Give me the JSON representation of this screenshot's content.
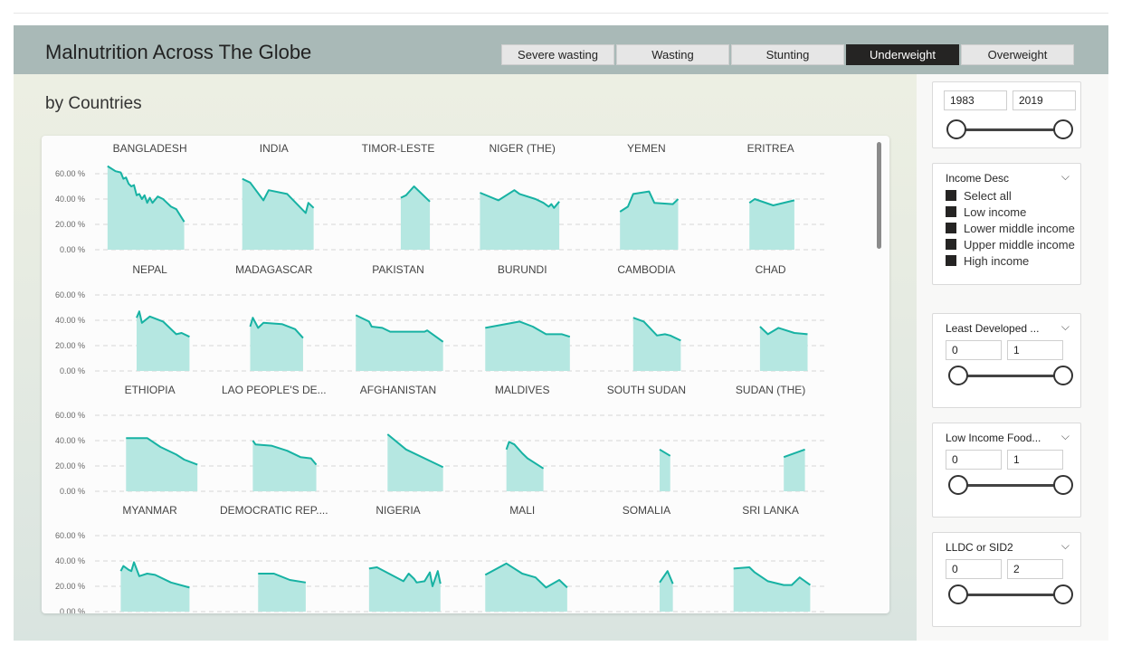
{
  "app": {
    "title": "Malnutrition Across The Globe",
    "subtitle": "by Countries"
  },
  "tabs": [
    {
      "label": "Severe wasting",
      "active": false
    },
    {
      "label": "Wasting",
      "active": false
    },
    {
      "label": "Stunting",
      "active": false
    },
    {
      "label": "Underweight",
      "active": true
    },
    {
      "label": "Overweight",
      "active": false
    }
  ],
  "colors": {
    "header": "#a9b9b7",
    "line": "#17b2a3",
    "area": "#b5e7e1",
    "active_tab": "#252423"
  },
  "filters": {
    "year_range": {
      "from": "1983",
      "to": "2019",
      "low_fraction": 0,
      "high_fraction": 1
    },
    "income": {
      "title": "Income Desc",
      "icon": "chevron-down-icon",
      "options": [
        "Select all",
        "Low income",
        "Lower middle income",
        "Upper middle income",
        "High income"
      ]
    },
    "ldc": {
      "title": "Least Developed ...",
      "from": "0",
      "to": "1",
      "low_fraction": 0,
      "high_fraction": 1
    },
    "lifdc": {
      "title": "Low Income Food...",
      "from": "0",
      "to": "1",
      "low_fraction": 0,
      "high_fraction": 1
    },
    "lldc": {
      "title": "LLDC or SID2",
      "from": "0",
      "to": "2",
      "low_fraction": 0,
      "high_fraction": 1
    }
  },
  "chart_data": {
    "type": "area",
    "y_ticks": [
      "60.00 %",
      "40.00 %",
      "20.00 %",
      "0.00 %"
    ],
    "ylim": [
      0,
      60
    ],
    "xlim": [
      1983,
      2019
    ],
    "grid": true,
    "panels": [
      {
        "name": "BANGLADESH",
        "points": [
          [
            1985,
            66
          ],
          [
            1988,
            62
          ],
          [
            1990,
            61
          ],
          [
            1991,
            56
          ],
          [
            1992,
            57
          ],
          [
            1993,
            52
          ],
          [
            1994,
            50
          ],
          [
            1995,
            51
          ],
          [
            1996,
            43
          ],
          [
            1997,
            44
          ],
          [
            1998,
            40
          ],
          [
            1999,
            43
          ],
          [
            2000,
            37
          ],
          [
            2001,
            41
          ],
          [
            2002,
            37
          ],
          [
            2004,
            42
          ],
          [
            2006,
            40
          ],
          [
            2007,
            38
          ],
          [
            2009,
            34
          ],
          [
            2011,
            32
          ],
          [
            2014,
            22
          ]
        ]
      },
      {
        "name": "INDIA",
        "points": [
          [
            1989,
            56
          ],
          [
            1992,
            53
          ],
          [
            1997,
            39
          ],
          [
            1999,
            47
          ],
          [
            2006,
            44
          ],
          [
            2013,
            29
          ],
          [
            2014,
            37
          ],
          [
            2016,
            33
          ]
        ]
      },
      {
        "name": "TIMOR-LESTE",
        "points": [
          [
            2002,
            41
          ],
          [
            2004,
            43
          ],
          [
            2007,
            50
          ],
          [
            2013,
            38
          ]
        ]
      },
      {
        "name": "NIGER (THE)",
        "points": [
          [
            1985,
            45
          ],
          [
            1992,
            39
          ],
          [
            1998,
            47
          ],
          [
            2000,
            44
          ],
          [
            2006,
            40
          ],
          [
            2009,
            37
          ],
          [
            2011,
            34
          ],
          [
            2012,
            36
          ],
          [
            2013,
            33
          ],
          [
            2015,
            38
          ]
        ]
      },
      {
        "name": "YEMEN",
        "points": [
          [
            1991,
            30
          ],
          [
            1994,
            34
          ],
          [
            1996,
            44
          ],
          [
            2002,
            46
          ],
          [
            2004,
            37
          ],
          [
            2011,
            36
          ],
          [
            2013,
            40
          ]
        ]
      },
      {
        "name": "ERITREA",
        "points": [
          [
            1993,
            37
          ],
          [
            1995,
            40
          ],
          [
            2002,
            35
          ],
          [
            2010,
            39
          ]
        ]
      },
      {
        "name": "NEPAL",
        "points": [
          [
            1996,
            42
          ],
          [
            1997,
            47
          ],
          [
            1998,
            38
          ],
          [
            2001,
            43
          ],
          [
            2006,
            39
          ],
          [
            2011,
            29
          ],
          [
            2013,
            30
          ],
          [
            2016,
            27
          ]
        ]
      },
      {
        "name": "MADAGASCAR",
        "points": [
          [
            1992,
            35
          ],
          [
            1993,
            42
          ],
          [
            1995,
            34
          ],
          [
            1997,
            38
          ],
          [
            2004,
            37
          ],
          [
            2009,
            33
          ],
          [
            2012,
            26
          ]
        ]
      },
      {
        "name": "PAKISTAN",
        "points": [
          [
            1985,
            44
          ],
          [
            1990,
            39
          ],
          [
            1991,
            35
          ],
          [
            1995,
            34
          ],
          [
            1998,
            31
          ],
          [
            2011,
            31
          ],
          [
            2012,
            32
          ],
          [
            2018,
            23
          ]
        ]
      },
      {
        "name": "BURUNDI",
        "points": [
          [
            1987,
            34
          ],
          [
            2000,
            39
          ],
          [
            2005,
            35
          ],
          [
            2010,
            29
          ],
          [
            2016,
            29
          ],
          [
            2019,
            27
          ]
        ]
      },
      {
        "name": "CAMBODIA",
        "points": [
          [
            1996,
            42
          ],
          [
            2000,
            39
          ],
          [
            2005,
            28
          ],
          [
            2008,
            29
          ],
          [
            2010,
            28
          ],
          [
            2014,
            24
          ]
        ]
      },
      {
        "name": "CHAD",
        "points": [
          [
            1997,
            35
          ],
          [
            2000,
            29
          ],
          [
            2004,
            34
          ],
          [
            2010,
            30
          ],
          [
            2015,
            29
          ]
        ]
      },
      {
        "name": "ETHIOPIA",
        "points": [
          [
            1992,
            42
          ],
          [
            2000,
            42
          ],
          [
            2005,
            35
          ],
          [
            2011,
            29
          ],
          [
            2014,
            25
          ],
          [
            2019,
            21
          ]
        ]
      },
      {
        "name": "LAO PEOPLE'S DE...",
        "points": [
          [
            1993,
            40
          ],
          [
            1994,
            37
          ],
          [
            2000,
            36
          ],
          [
            2006,
            32
          ],
          [
            2011,
            27
          ],
          [
            2015,
            26
          ],
          [
            2017,
            21
          ]
        ]
      },
      {
        "name": "AFGHANISTAN",
        "points": [
          [
            1997,
            45
          ],
          [
            2004,
            33
          ],
          [
            2018,
            19
          ]
        ]
      },
      {
        "name": "MALDIVES",
        "points": [
          [
            1995,
            33
          ],
          [
            1996,
            39
          ],
          [
            1998,
            37
          ],
          [
            2001,
            30
          ],
          [
            2003,
            26
          ],
          [
            2009,
            18
          ]
        ]
      },
      {
        "name": "SOUTH SUDAN",
        "points": [
          [
            2006,
            33
          ],
          [
            2010,
            28
          ]
        ]
      },
      {
        "name": "SUDAN (THE)",
        "points": [
          [
            2006,
            27
          ],
          [
            2014,
            33
          ]
        ]
      },
      {
        "name": "MYANMAR",
        "points": [
          [
            1990,
            32
          ],
          [
            1991,
            36
          ],
          [
            1993,
            33
          ],
          [
            1994,
            32
          ],
          [
            1995,
            39
          ],
          [
            1997,
            28
          ],
          [
            2000,
            30
          ],
          [
            2003,
            29
          ],
          [
            2009,
            23
          ],
          [
            2016,
            19
          ]
        ]
      },
      {
        "name": "DEMOCRATIC REP....",
        "points": [
          [
            1995,
            30
          ],
          [
            2001,
            30
          ],
          [
            2007,
            25
          ],
          [
            2013,
            23
          ]
        ]
      },
      {
        "name": "NIGERIA",
        "points": [
          [
            1990,
            34
          ],
          [
            1993,
            35
          ],
          [
            2003,
            24
          ],
          [
            2005,
            30
          ],
          [
            2007,
            26
          ],
          [
            2008,
            23
          ],
          [
            2011,
            24
          ],
          [
            2013,
            31
          ],
          [
            2014,
            20
          ],
          [
            2016,
            32
          ],
          [
            2017,
            22
          ]
        ]
      },
      {
        "name": "MALI",
        "points": [
          [
            1987,
            29
          ],
          [
            1995,
            38
          ],
          [
            2001,
            30
          ],
          [
            2006,
            27
          ],
          [
            2010,
            19
          ],
          [
            2015,
            25
          ],
          [
            2018,
            19
          ]
        ]
      },
      {
        "name": "SOMALIA",
        "points": [
          [
            2006,
            23
          ],
          [
            2009,
            32
          ],
          [
            2011,
            22
          ]
        ]
      },
      {
        "name": "SRI LANKA",
        "points": [
          [
            1987,
            34
          ],
          [
            1993,
            35
          ],
          [
            1995,
            31
          ],
          [
            2000,
            24
          ],
          [
            2006,
            21
          ],
          [
            2009,
            21
          ],
          [
            2012,
            27
          ],
          [
            2016,
            21
          ]
        ]
      }
    ]
  }
}
